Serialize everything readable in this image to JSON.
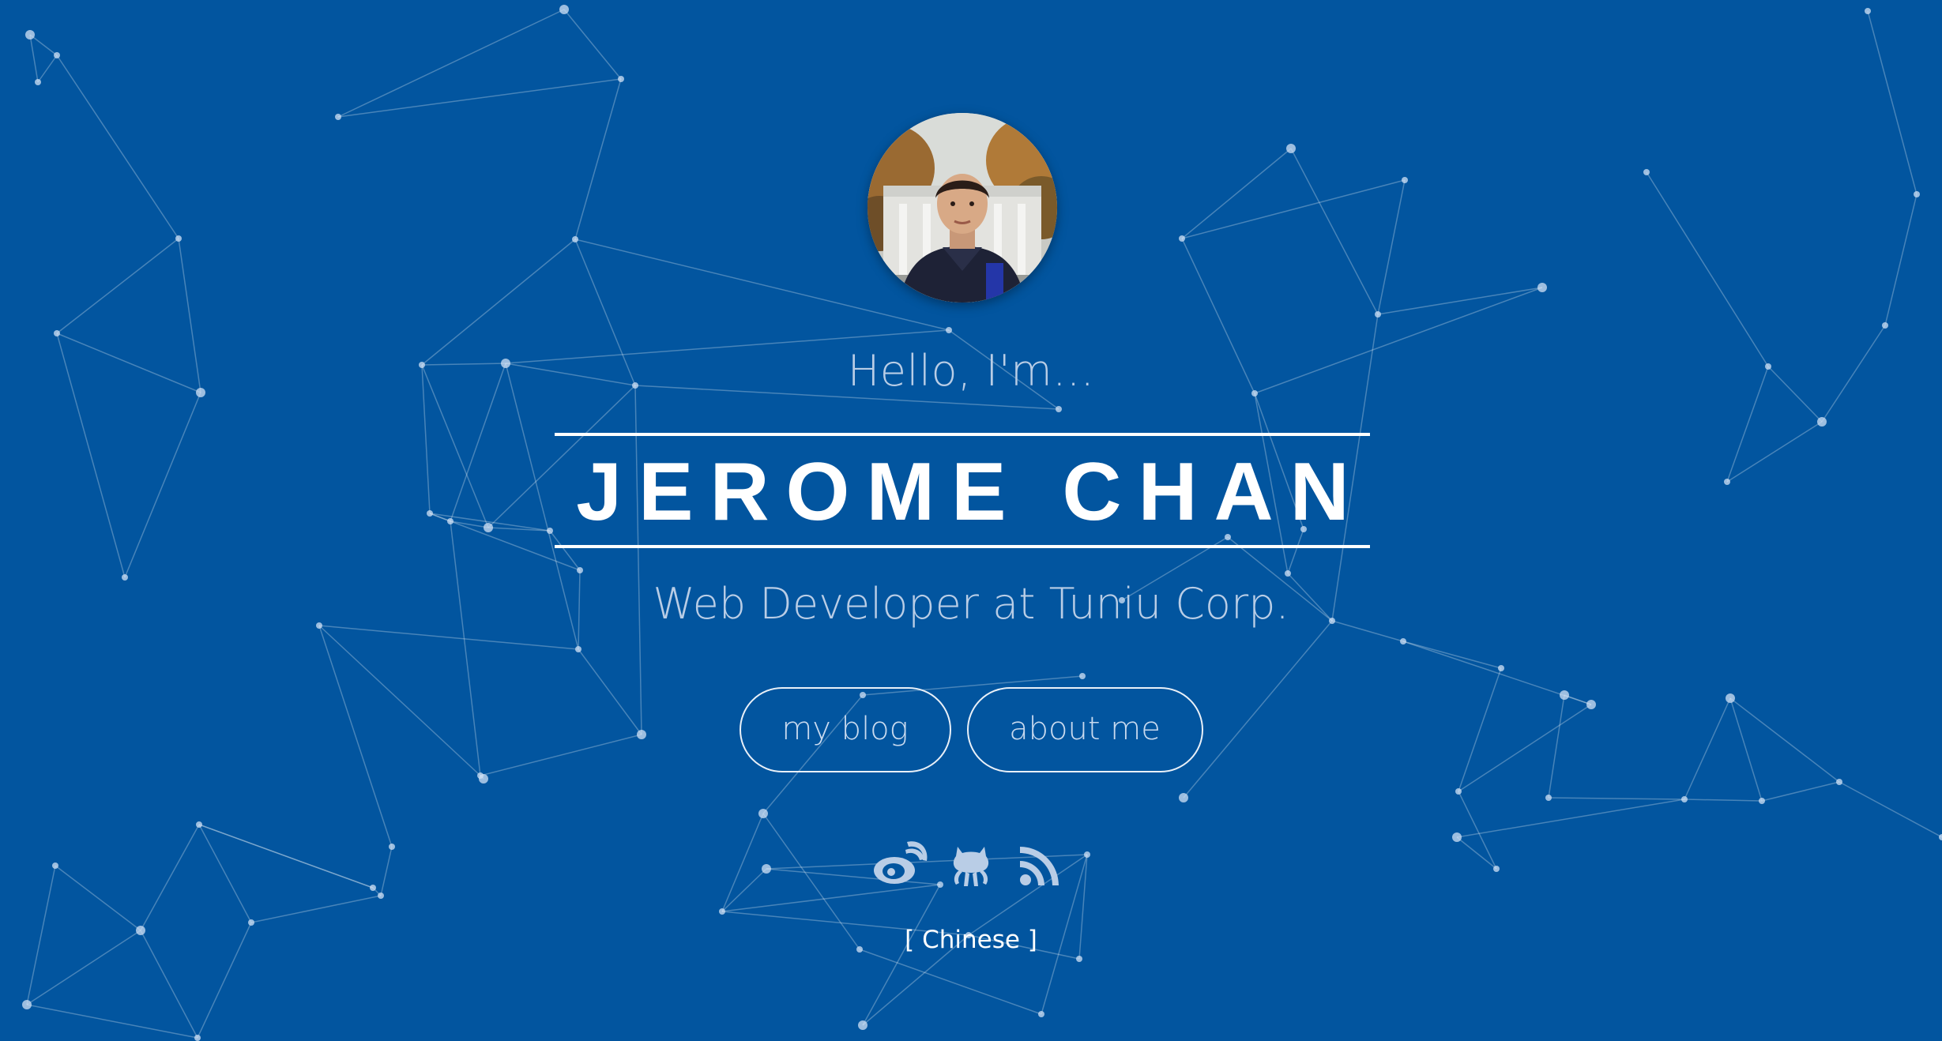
{
  "profile": {
    "avatar_label": "profile photo",
    "greeting": "Hello, I'm...",
    "name": "JEROME CHAN",
    "subtitle": "Web Developer at Tuniu Corp."
  },
  "nav": {
    "blog_label": "my blog",
    "about_label": "about me"
  },
  "social": [
    {
      "icon": "weibo-icon"
    },
    {
      "icon": "github-icon"
    },
    {
      "icon": "rss-icon"
    }
  ],
  "language": {
    "open_bracket": "[",
    "label": "Chinese",
    "close_bracket": "]"
  },
  "colors": {
    "background": "#02559f",
    "text_muted": "#b9cde6",
    "text_primary": "#ffffff",
    "network_line": "rgba(255,255,255,0.28)"
  }
}
